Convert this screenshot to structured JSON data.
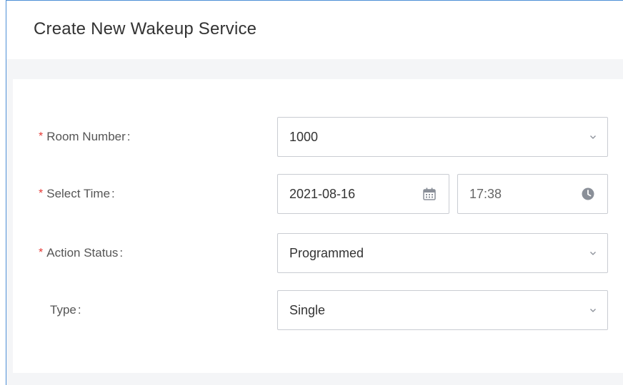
{
  "dialog": {
    "title": "Create New Wakeup Service"
  },
  "form": {
    "room_number": {
      "label": "Room Number",
      "colon": ":",
      "value": "1000",
      "icon": "chevron-down-icon"
    },
    "select_time": {
      "label": "Select Time",
      "colon": ":",
      "date": "2021-08-16",
      "time": "17:38",
      "date_icon": "calendar-icon",
      "time_icon": "clock-icon"
    },
    "action_status": {
      "label": "Action Status",
      "colon": ":",
      "value": "Programmed",
      "icon": "chevron-down-icon"
    },
    "type": {
      "label": "Type",
      "colon": ":",
      "value": "Single",
      "icon": "chevron-down-icon"
    },
    "required_mark": "*"
  },
  "colors": {
    "border_accent": "#4d8fd6",
    "required": "#e53935",
    "icon": "#8a8f98",
    "panel_bg": "#f4f5f7"
  }
}
